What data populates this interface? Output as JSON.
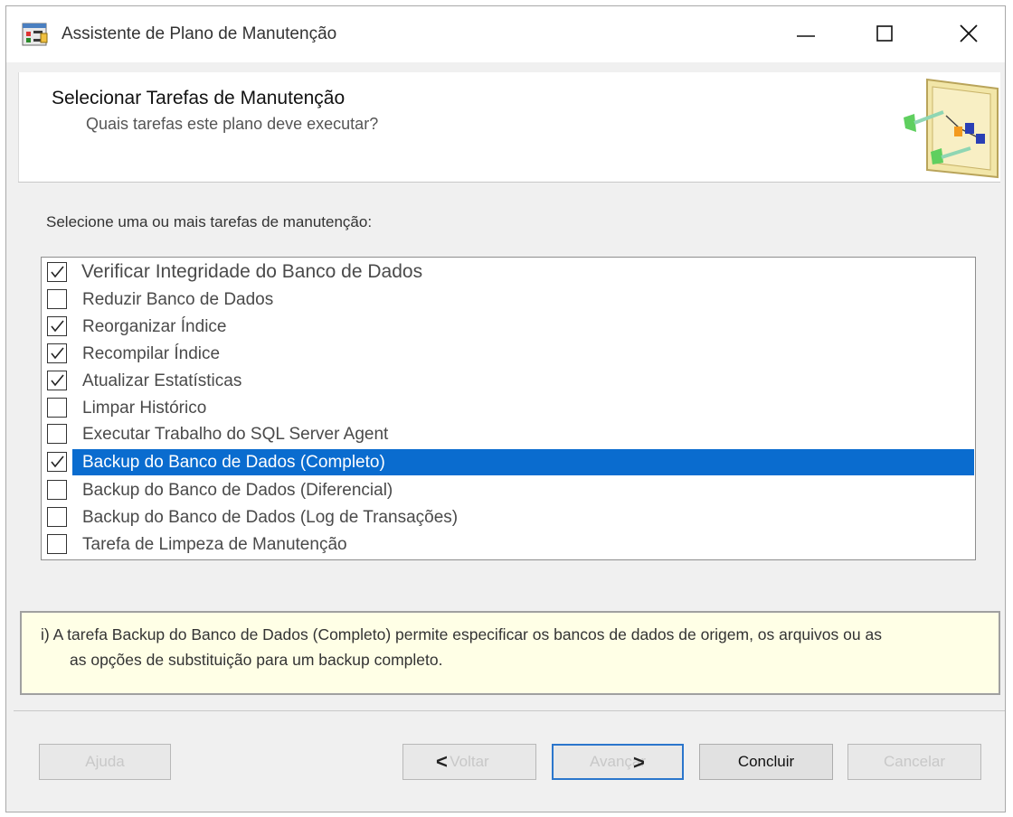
{
  "window": {
    "title": "Assistente de Plano de Manutenção",
    "controls": {
      "minimize": "minimize",
      "maximize": "maximize",
      "close": "close"
    }
  },
  "header": {
    "title": "Selecionar Tarefas de Manutenção",
    "subtitle": "Quais tarefas este plano deve executar?"
  },
  "instruction": "Selecione uma ou mais tarefas de manutenção:",
  "tasks": [
    {
      "label": "Verificar Integridade do Banco de Dados",
      "checked": true
    },
    {
      "label": "Reduzir Banco de Dados",
      "checked": false
    },
    {
      "label": "Reorganizar Índice",
      "checked": true
    },
    {
      "label": "Recompilar Índice",
      "checked": true
    },
    {
      "label": "Atualizar Estatísticas",
      "checked": true
    },
    {
      "label": "Limpar Histórico",
      "checked": false
    },
    {
      "label": "Executar Trabalho do SQL Server Agent",
      "checked": false
    },
    {
      "label": "Backup do Banco de Dados (Completo)",
      "checked": true,
      "selected": true
    },
    {
      "label": "Backup do Banco de Dados (Diferencial)",
      "checked": false
    },
    {
      "label": "Backup do Banco de Dados (Log de Transações)",
      "checked": false
    },
    {
      "label": "Tarefa de Limpeza de Manutenção",
      "checked": false
    }
  ],
  "description": {
    "line1": "i) A tarefa Backup do Banco de Dados (Completo) permite especificar os bancos de dados de origem, os arquivos ou as",
    "line2": "as opções de substituição para um backup completo."
  },
  "buttons": {
    "help": "Ajuda",
    "back": "Voltar",
    "next": "Avançar",
    "finish": "Concluir",
    "cancel": "Cancelar"
  },
  "colors": {
    "selection": "#0a6ccf",
    "description_bg": "#ffffe6",
    "focus_border": "#2b76cc"
  },
  "icons": {
    "app": "maintenance-plan-icon",
    "header_art": "wizard-flowchart-icon"
  }
}
